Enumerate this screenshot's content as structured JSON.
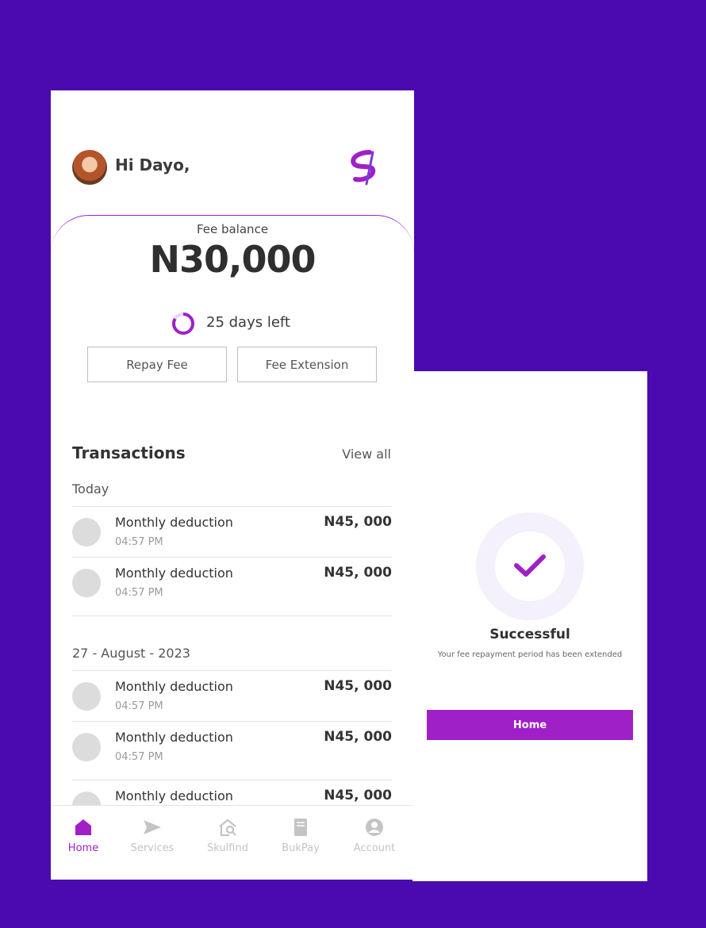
{
  "colors": {
    "background": "#4a0ab0",
    "accent": "#a020c8",
    "muted": "#c4c4c4"
  },
  "header": {
    "greeting": "Hi Dayo,",
    "avatar_icon": "user-avatar",
    "logo_icon": "brand-logo"
  },
  "balance": {
    "label": "Fee balance",
    "amount": "N30,000",
    "days_left": "25 days left",
    "days_progress": 0.83
  },
  "actions": {
    "repay_label": "Repay Fee",
    "extension_label": "Fee Extension"
  },
  "transactions": {
    "title": "Transactions",
    "view_all": "View all",
    "groups": [
      {
        "label": "Today",
        "items": [
          {
            "name": "Monthly deduction",
            "time": "04:57 PM",
            "amount": "N45, 000"
          },
          {
            "name": "Monthly deduction",
            "time": "04:57 PM",
            "amount": "N45, 000"
          }
        ]
      },
      {
        "label": "27 - August - 2023",
        "items": [
          {
            "name": "Monthly deduction",
            "time": "04:57 PM",
            "amount": "N45, 000"
          },
          {
            "name": "Monthly deduction",
            "time": "04:57 PM",
            "amount": "N45, 000"
          },
          {
            "name": "Monthly deduction",
            "time": "",
            "amount": "N45, 000"
          }
        ]
      }
    ]
  },
  "nav": {
    "items": [
      {
        "label": "Home",
        "icon": "home-icon",
        "active": true
      },
      {
        "label": "Services",
        "icon": "send-icon",
        "active": false
      },
      {
        "label": "Skulfind",
        "icon": "search-school-icon",
        "active": false
      },
      {
        "label": "BukPay",
        "icon": "book-icon",
        "active": false
      },
      {
        "label": "Account",
        "icon": "account-icon",
        "active": false
      }
    ]
  },
  "success": {
    "icon": "check-icon",
    "title": "Successful",
    "message": "Your fee repayment period has been extended",
    "button_label": "Home"
  }
}
